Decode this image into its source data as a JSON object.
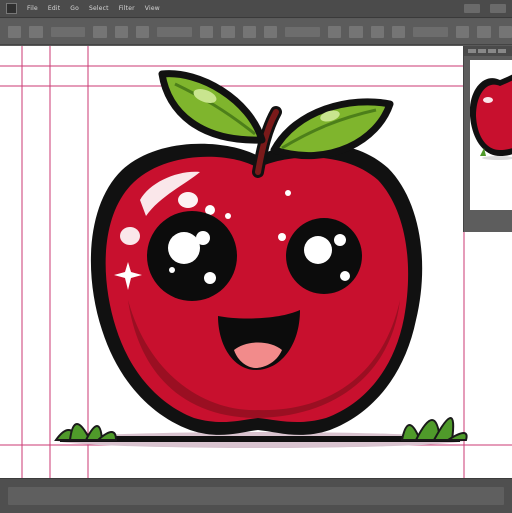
{
  "menu": {
    "items": [
      "File",
      "Edit",
      "Go",
      "Select",
      "Filter",
      "View"
    ]
  },
  "colors": {
    "apple_red": "#c8102e",
    "apple_dark": "#8e0f1f",
    "leaf_green": "#7fb52d",
    "guide_magenta": "#c2185b",
    "ui_dark": "#4b4b4b"
  },
  "icons": {
    "apple": "apple-illustration",
    "leaf": "leaf-icon",
    "sparkle": "sparkle-icon"
  }
}
